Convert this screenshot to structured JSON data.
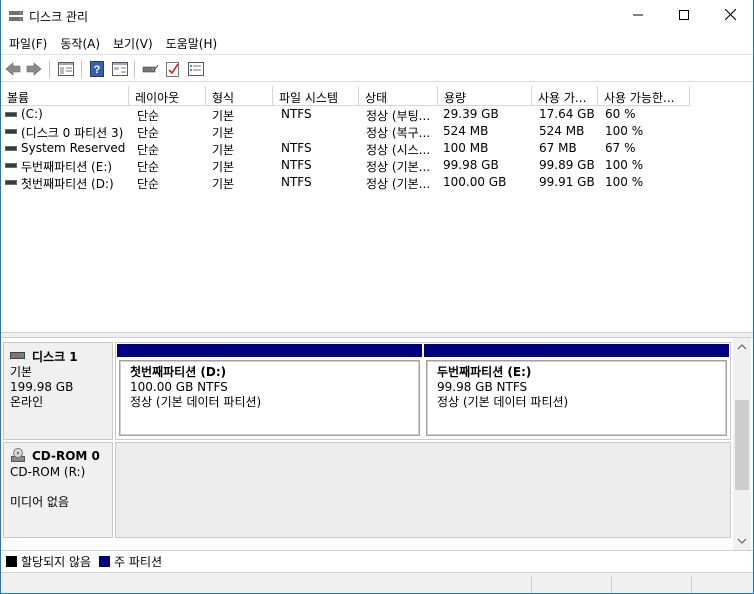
{
  "window": {
    "title": "디스크 관리",
    "minimize_icon": "minimize-icon",
    "maximize_icon": "maximize-icon",
    "close_icon": "close-icon"
  },
  "menu": [
    "파일(F)",
    "동작(A)",
    "보기(V)",
    "도움말(H)"
  ],
  "toolbar_icons": [
    "back-arrow-icon",
    "forward-arrow-icon",
    "console-tree-icon",
    "help-icon",
    "properties-icon",
    "connect-drive-icon",
    "check-icon",
    "view-icon"
  ],
  "columns": [
    "볼륨",
    "레이아웃",
    "형식",
    "파일 시스템",
    "상태",
    "용량",
    "사용 가...",
    "사용 가능한..."
  ],
  "volumes": [
    {
      "name": " (C:)",
      "layout": "단순",
      "type": "기본",
      "fs": "NTFS",
      "status": "정상 (부팅...",
      "capacity": "29.39 GB",
      "free": "17.64 GB",
      "pct": "60 %"
    },
    {
      "name": "(디스크 0 파티션 3)",
      "layout": "단순",
      "type": "기본",
      "fs": "",
      "status": "정상 (복구...",
      "capacity": "524 MB",
      "free": "524 MB",
      "pct": "100 %"
    },
    {
      "name": "System Reserved",
      "layout": "단순",
      "type": "기본",
      "fs": "NTFS",
      "status": "정상 (시스...",
      "capacity": "100 MB",
      "free": "67 MB",
      "pct": "67 %"
    },
    {
      "name": "두번째파티션 (E:)",
      "layout": "단순",
      "type": "기본",
      "fs": "NTFS",
      "status": "정상 (기본...",
      "capacity": "99.98 GB",
      "free": "99.89 GB",
      "pct": "100 %"
    },
    {
      "name": "첫번째파티션 (D:)",
      "layout": "단순",
      "type": "기본",
      "fs": "NTFS",
      "status": "정상 (기본...",
      "capacity": "100.00 GB",
      "free": "99.91 GB",
      "pct": "100 %"
    }
  ],
  "disks": [
    {
      "title": "디스크 1",
      "kind": "기본",
      "size": "199.98 GB",
      "state": "온라인",
      "partitions": [
        {
          "name": "첫번째파티션  (D:)",
          "size_fs": "100.00 GB NTFS",
          "status": "정상 (기본 데이터 파티션)"
        },
        {
          "name": "두번째파티션  (E:)",
          "size_fs": "99.98 GB NTFS",
          "status": "정상 (기본 데이터 파티션)"
        }
      ]
    },
    {
      "title": "CD-ROM 0",
      "kind": "CD-ROM (R:)",
      "state": "미디어 없음"
    }
  ],
  "legend": {
    "unallocated": "할당되지 않음",
    "primary": "주 파티션"
  },
  "colors": {
    "primary_partition": "#000080",
    "unallocated": "#000000",
    "window_border": "#1979ca"
  }
}
